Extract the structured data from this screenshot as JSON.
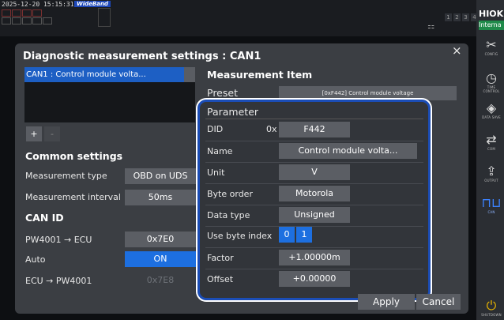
{
  "status": {
    "timestamp": "2025-12-20  15:15:31",
    "bandwidth_badge": "WideBand",
    "channel_numbers": [
      "1",
      "2",
      "3",
      "4"
    ]
  },
  "sidebar": {
    "brand": "HIOKI",
    "mode": "Interna",
    "buttons": [
      {
        "label": "CONFIG",
        "icon": "tools-icon"
      },
      {
        "label": "TIME CONTROL",
        "icon": "stopwatch-icon"
      },
      {
        "label": "DATA SAVE",
        "icon": "data-save-icon"
      },
      {
        "label": "COM",
        "icon": "com-icon"
      },
      {
        "label": "OUTPUT",
        "icon": "output-icon"
      },
      {
        "label": "CAN",
        "icon": "can-wave-icon"
      },
      {
        "label": "SHUTDOWN",
        "icon": "power-icon"
      }
    ]
  },
  "dialog": {
    "title": "Diagnostic measurement settings : CAN1",
    "list_items": [
      "CAN1 : Control module volta..."
    ],
    "add_label": "+",
    "remove_label": "-",
    "common_settings": {
      "heading": "Common settings",
      "measurement_type_label": "Measurement type",
      "measurement_type_value": "OBD on UDS",
      "measurement_interval_label": "Measurement interval",
      "measurement_interval_value": "50ms"
    },
    "can_id": {
      "heading": "CAN ID",
      "pw_to_ecu_label": "PW4001 → ECU",
      "pw_to_ecu_value": "0x7E0",
      "auto_label": "Auto",
      "auto_value": "ON",
      "ecu_to_pw_label": "ECU → PW4001",
      "ecu_to_pw_value": "0x7E8"
    },
    "measurement_item": {
      "heading": "Measurement Item",
      "preset_label": "Preset",
      "preset_value": "[0xF442] Control module voltage"
    },
    "parameter": {
      "heading": "Parameter",
      "did_label": "DID",
      "did_prefix": "0x",
      "did_value": "F442",
      "name_label": "Name",
      "name_value": "Control module volta...",
      "unit_label": "Unit",
      "unit_value": "V",
      "byte_order_label": "Byte order",
      "byte_order_value": "Motorola",
      "data_type_label": "Data type",
      "data_type_value": "Unsigned",
      "use_byte_index_label": "Use byte index",
      "byte_index_values": [
        "0",
        "1"
      ],
      "factor_label": "Factor",
      "factor_value": "+1.00000m",
      "offset_label": "Offset",
      "offset_value": "+0.00000"
    },
    "apply_label": "Apply",
    "cancel_label": "Cancel",
    "close_label": "×"
  }
}
